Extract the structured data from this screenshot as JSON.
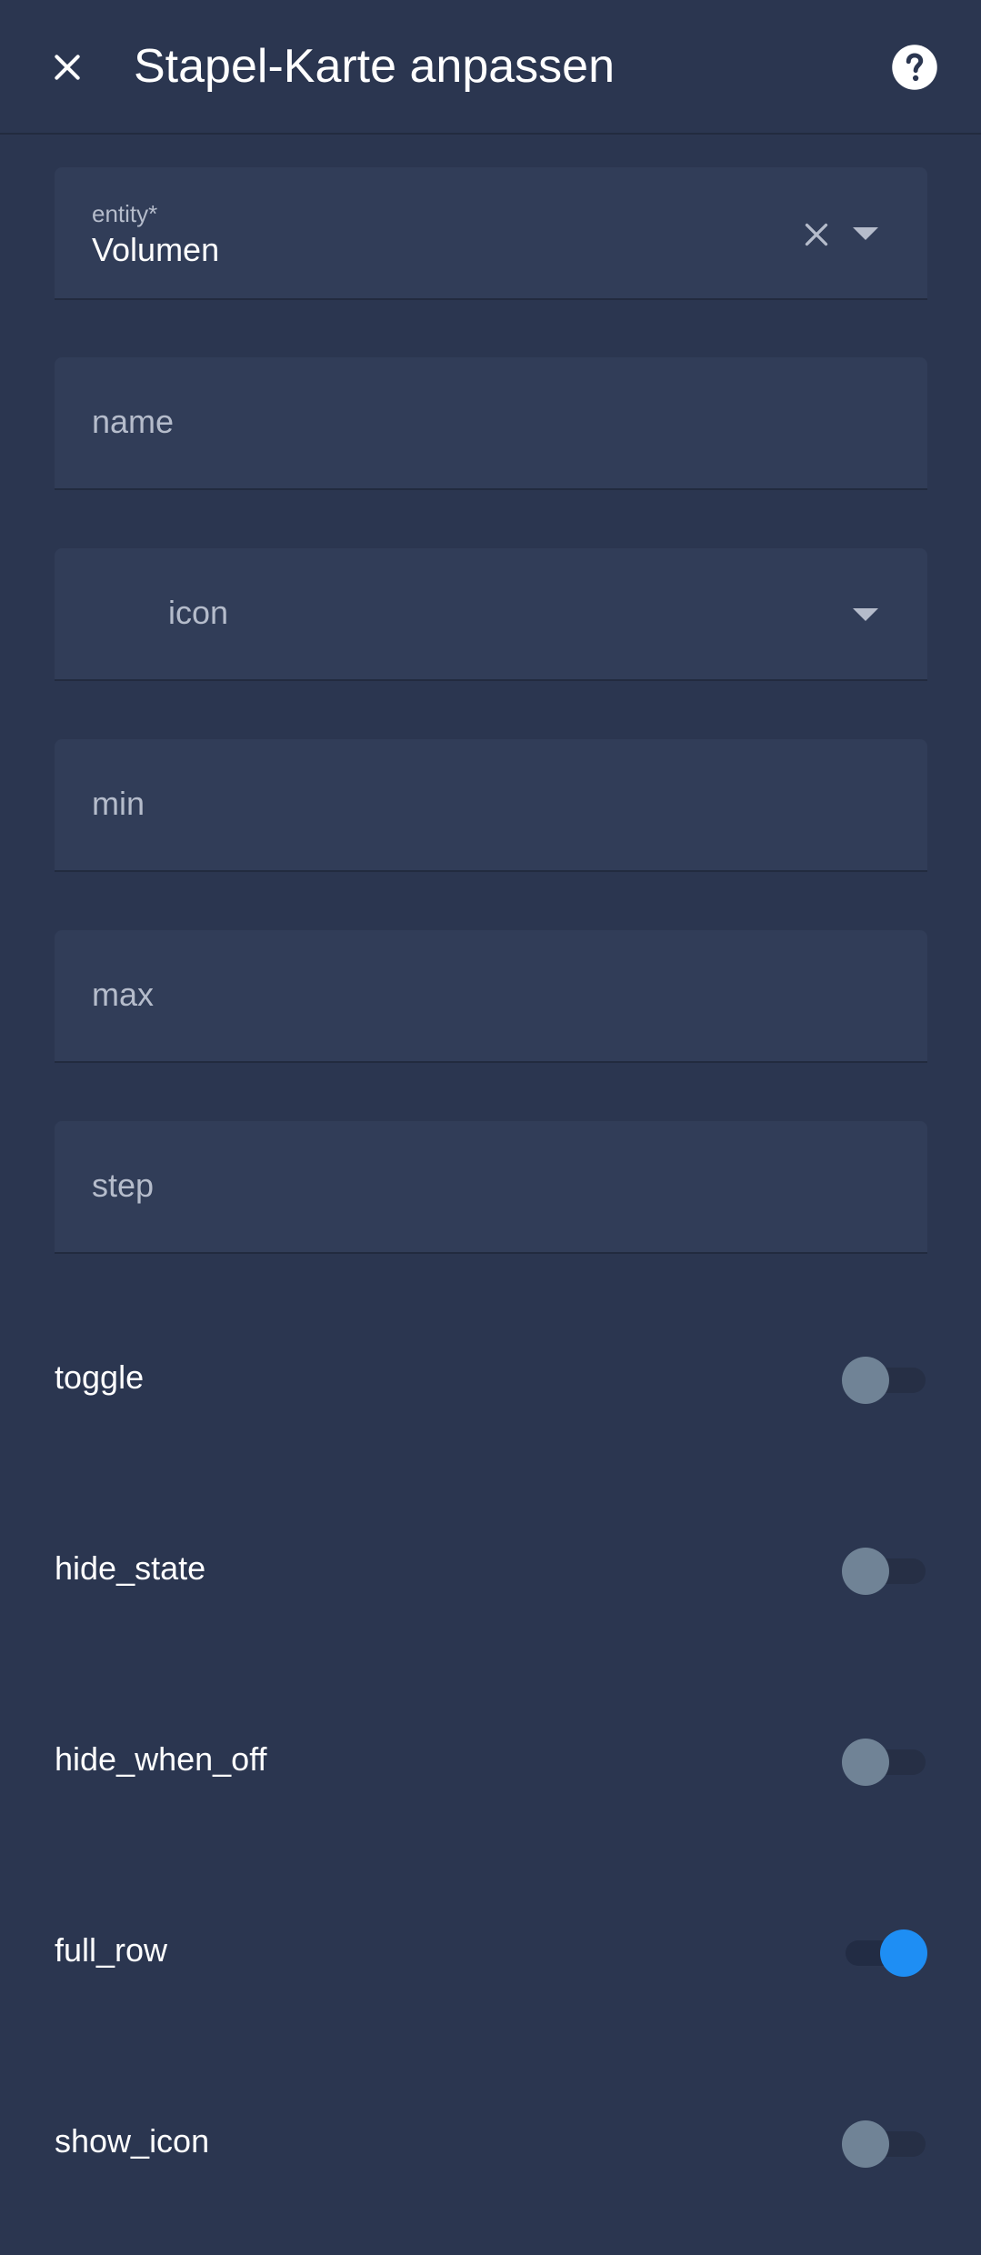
{
  "header": {
    "title": "Stapel-Karte anpassen",
    "close_icon": "close-icon",
    "help_icon": "help-circle-icon"
  },
  "fields": {
    "entity": {
      "label": "entity*",
      "value": "Volumen"
    },
    "name": {
      "placeholder": "name"
    },
    "icon": {
      "placeholder": "icon"
    },
    "min": {
      "placeholder": "min"
    },
    "max": {
      "placeholder": "max"
    },
    "step": {
      "placeholder": "step"
    }
  },
  "toggles": [
    {
      "label": "toggle",
      "on": false
    },
    {
      "label": "hide_state",
      "on": false
    },
    {
      "label": "hide_when_off",
      "on": false
    },
    {
      "label": "full_row",
      "on": true
    },
    {
      "label": "show_icon",
      "on": false
    }
  ],
  "colors": {
    "background": "#2b3650",
    "field_bg": "#313d58",
    "switch_on": "#1e8ef4",
    "switch_off_thumb": "#708396"
  }
}
